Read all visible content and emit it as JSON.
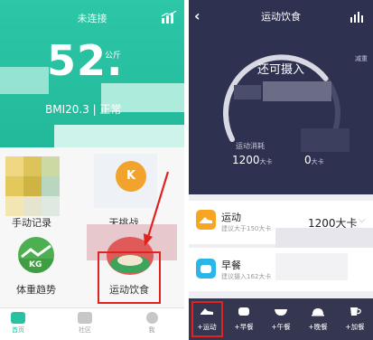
{
  "left_screen": {
    "header": {
      "status": "未连接",
      "chart_icon": "bar-chart-icon",
      "weight_value": "52.",
      "weight_unit": "公斤",
      "bmi_text": "BMI20.3 | 正常",
      "bg_color": "#26BE9F"
    },
    "grid": {
      "tile1_label": "手动记录",
      "tile2_label": "天挑战",
      "tile2_badge": "K",
      "tile3_label": "体重趋势",
      "tile3_badge": "KG",
      "tile4_label": "运动饮食"
    },
    "tabbar": {
      "items": [
        {
          "label": "首页",
          "icon": "home-icon",
          "active": true
        },
        {
          "label": "社区",
          "icon": "community-icon",
          "active": false
        },
        {
          "label": "我",
          "icon": "profile-icon",
          "active": false
        }
      ]
    }
  },
  "right_screen": {
    "header": {
      "back_icon": "back-chevron-icon",
      "title": "运动饮食",
      "remain_label": "还可摄入",
      "reduce_label": "减重",
      "sport_label": "运动消耗",
      "sport_value": "1200",
      "sport_unit": "大卡",
      "other_value": "0",
      "other_unit": "大卡",
      "ring_progress": 0.72,
      "bg_color": "#2E3150"
    },
    "cards": [
      {
        "title": "运动",
        "subtitle": "建议大于150大卡",
        "value": "1200大卡",
        "icon": "sport-shoe-icon",
        "icon_color": "#F6A623"
      },
      {
        "title": "早餐",
        "subtitle": "建议摄入162大卡",
        "icon": "breakfast-icon",
        "icon_color": "#2CB5E8"
      }
    ],
    "toolbar": {
      "items": [
        {
          "label": "+运动",
          "icon": "shoe-icon"
        },
        {
          "label": "+早餐",
          "icon": "bread-icon"
        },
        {
          "label": "+午餐",
          "icon": "bowl-icon"
        },
        {
          "label": "+晚餐",
          "icon": "cloche-icon"
        },
        {
          "label": "+加餐",
          "icon": "cup-icon"
        }
      ],
      "bg_color": "#34374F"
    }
  },
  "annotation_color": "#E0231E"
}
